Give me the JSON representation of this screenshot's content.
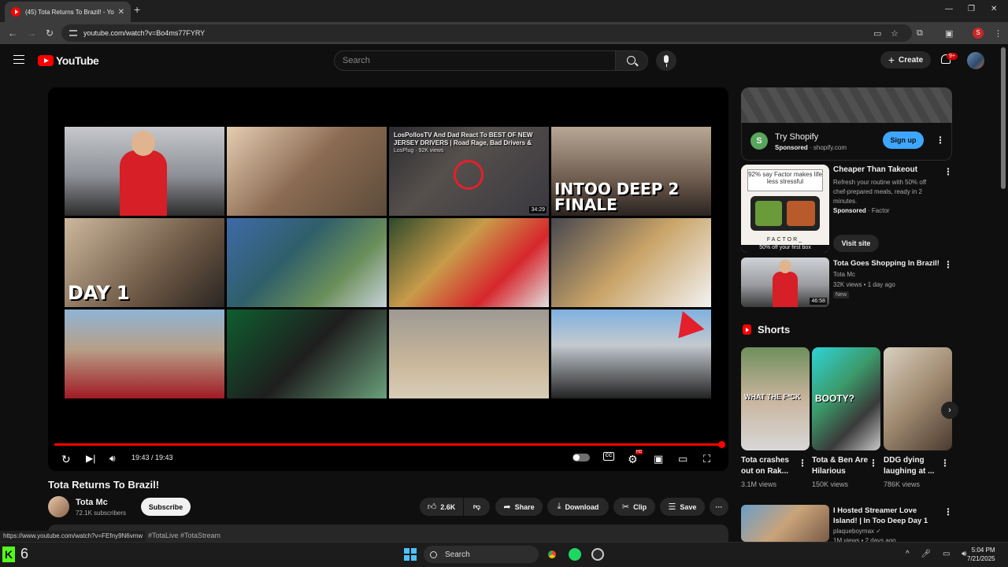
{
  "browser": {
    "tab_title": "(45) Tota Returns To Brazil! - Yo",
    "tab_close": "✕",
    "new_tab": "+",
    "url": "youtube.com/watch?v=Bo4ms77FYRY",
    "profile_initial": "S",
    "status_url": "https://www.youtube.com/watch?v=FEfny9N6vmw"
  },
  "header": {
    "logo_text": "YouTube",
    "search_placeholder": "Search",
    "create_label": "Create",
    "notification_count": "9+"
  },
  "player": {
    "thumbnails": [
      {
        "caption": "",
        "theme": "store-red-jacket"
      },
      {
        "caption": "",
        "theme": "gta-tongue"
      },
      {
        "caption": "",
        "theme": "car-reaction",
        "hover_title": "LosPollosTV And Dad React To BEST OF NEW JERSEY DRIVERS | Road Rage, Bad Drivers &",
        "hover_channel": "LosPlug · 92K views",
        "duration": "34:29"
      },
      {
        "caption": "INTOO DEEP 2 FINALE",
        "theme": "group-finale"
      },
      {
        "caption": "DAY 1",
        "theme": "group-day1"
      },
      {
        "caption": "",
        "theme": "cliff-hike"
      },
      {
        "caption": "",
        "theme": "mario-hat"
      },
      {
        "caption": "",
        "theme": "car-selfie"
      },
      {
        "caption": "",
        "theme": "monaco-group"
      },
      {
        "caption": "",
        "theme": "coin-money"
      },
      {
        "caption": "",
        "theme": "beach-dig"
      },
      {
        "caption": "",
        "theme": "sports-car"
      }
    ],
    "time_display": "19:43 / 19:43",
    "progress_fraction": 1.0,
    "cc_label": "CC",
    "hd_badge": "HD"
  },
  "video": {
    "title": "Tota Returns To Brazil!",
    "channel": "Tota Mc",
    "subscribers": "72.1K subscribers",
    "subscribe_label": "Subscribe",
    "likes": "2.6K",
    "share_label": "Share",
    "download_label": "Download",
    "clip_label": "Clip",
    "save_label": "Save",
    "more_label": "···",
    "hashtags": "#TotaLive #TotaStream"
  },
  "sidebar": {
    "ad1": {
      "name": "Try Shopify",
      "sponsored": "Sponsored",
      "domain": "· shopify.com",
      "cta": "Sign up"
    },
    "ad2": {
      "title": "Cheaper Than Takeout",
      "description": "Refresh your routine with 50% off chef-prepared meals, ready in 2 minutes.",
      "sponsored": "Sponsored",
      "advertiser": "· Factor",
      "cta": "Visit site",
      "image_tagline": "92% say Factor makes life less stressful",
      "image_brand": "FACTOR_",
      "image_offer": "50% off your first box"
    },
    "rec1": {
      "title": "Tota Goes Shopping In Brazil!",
      "channel": "Tota Mc",
      "meta": "32K views • 1 day ago",
      "badge": "New",
      "duration": "46:58"
    },
    "shorts_heading": "Shorts",
    "shorts": [
      {
        "title": "Tota crashes out on Rak...",
        "views": "3.1M views",
        "overlay": "WHAT THE F*CK"
      },
      {
        "title": "Tota & Ben Are Hilarious",
        "views": "150K views",
        "overlay": "BOOTY?"
      },
      {
        "title": "DDG dying laughing at ...",
        "views": "786K views",
        "overlay": ""
      }
    ],
    "rec2": {
      "title": "I Hosted Streamer Love Island! | In Too Deep Day 1",
      "channel": "plaqueboymax ✓",
      "meta": "1M views • 2 days ago"
    }
  },
  "taskbar": {
    "kick_count": "6",
    "search_label": "Search",
    "time": "5:04 PM",
    "date": "7/21/2025"
  },
  "colors": {
    "accent_red": "#ff0000",
    "signup_blue": "#3ea6ff",
    "background": "#0f0f0f"
  }
}
